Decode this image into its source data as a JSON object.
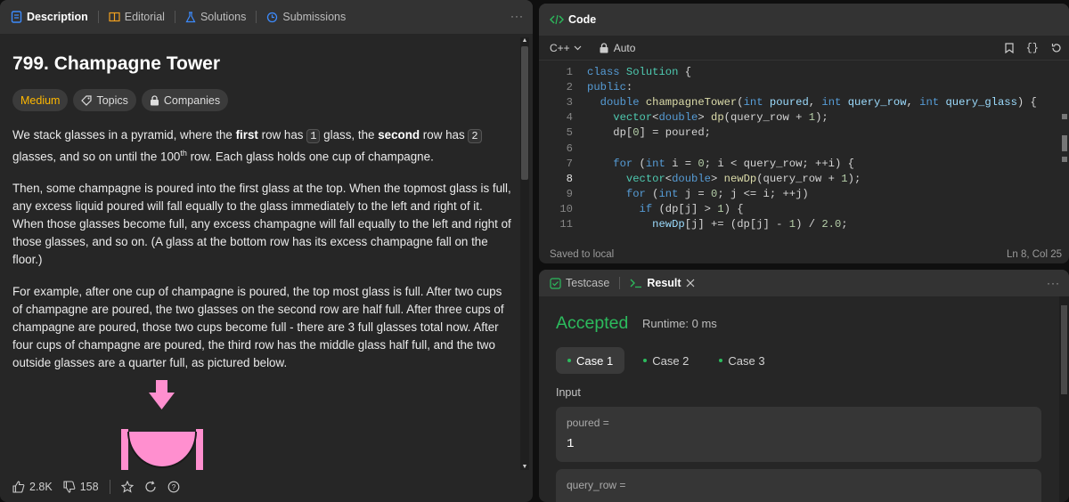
{
  "left_tabs": [
    {
      "label": "Description",
      "icon": "document-icon"
    },
    {
      "label": "Editorial",
      "icon": "book-icon"
    },
    {
      "label": "Solutions",
      "icon": "flask-icon"
    },
    {
      "label": "Submissions",
      "icon": "history-icon"
    }
  ],
  "problem": {
    "title": "799. Champagne Tower",
    "difficulty": "Medium",
    "topics_label": "Topics",
    "companies_label": "Companies",
    "p1": {
      "a": "We stack glasses in a pyramid, where the ",
      "b": "first",
      "c": " row has ",
      "d": "1",
      "e": " glass, the ",
      "f": "second",
      "g": " row has ",
      "h": "2",
      "i": " glasses, and so on until the 100",
      "sup": "th",
      "j": " row.  Each glass holds one cup of champagne."
    },
    "p2": "Then, some champagne is poured into the first glass at the top.  When the topmost glass is full, any excess liquid poured will fall equally to the glass immediately to the left and right of it.  When those glasses become full, any excess champagne will fall equally to the left and right of those glasses, and so on.  (A glass at the bottom row has its excess champagne fall on the floor.)",
    "p3": "For example, after one cup of champagne is poured, the top most glass is full.  After two cups of champagne are poured, the two glasses on the second row are half full.  After three cups of champagne are poured, those two cups become full - there are 3 full glasses total now.  After four cups of champagne are poured, the third row has the middle glass half full, and the two outside glasses are a quarter full, as pictured below."
  },
  "footer": {
    "likes": "2.8K",
    "dislikes": "158"
  },
  "code_panel": {
    "title": "Code",
    "language": "C++",
    "mode": "Auto",
    "lines": [
      "1",
      "2",
      "3",
      "4",
      "5",
      "6",
      "7",
      "8",
      "9",
      "10",
      "11"
    ],
    "saved": "Saved to local",
    "position": "Ln 8, Col 25"
  },
  "result_panel": {
    "testcase_tab": "Testcase",
    "result_tab": "Result",
    "status": "Accepted",
    "runtime": "Runtime: 0 ms",
    "cases": [
      "Case 1",
      "Case 2",
      "Case 3"
    ],
    "input_label": "Input",
    "fields": [
      {
        "name": "poured =",
        "value": "1"
      },
      {
        "name": "query_row =",
        "value": ""
      }
    ]
  },
  "colors": {
    "accent_green": "#2cbb5d",
    "medium": "#ffb800",
    "glass": "#ff8fcf"
  }
}
